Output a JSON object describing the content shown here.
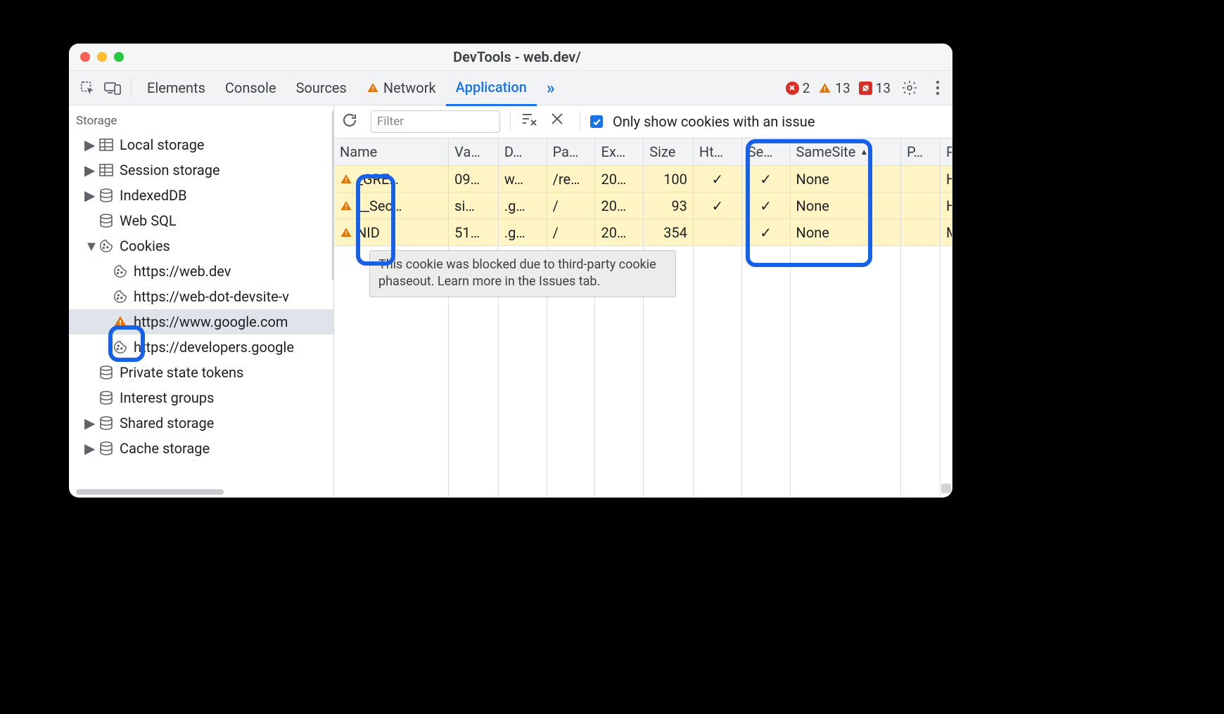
{
  "title": "DevTools - web.dev/",
  "tabs": {
    "elements": "Elements",
    "console": "Console",
    "sources": "Sources",
    "network": "Network",
    "application": "Application"
  },
  "counts": {
    "errors": "2",
    "warnings": "13",
    "issues": "13"
  },
  "sidebar": {
    "header": "Storage",
    "local_storage": "Local storage",
    "session_storage": "Session storage",
    "indexeddb": "IndexedDB",
    "websql": "Web SQL",
    "cookies": "Cookies",
    "cookie_children": {
      "0": "https://web.dev",
      "1": "https://web-dot-devsite-v",
      "2": "https://www.google.com",
      "3": "https://developers.google"
    },
    "private_state": "Private state tokens",
    "interest_groups": "Interest groups",
    "shared_storage": "Shared storage",
    "cache_storage": "Cache storage"
  },
  "toolbar": {
    "filter_placeholder": "Filter",
    "only_issues_label": "Only show cookies with an issue"
  },
  "columns": {
    "name": "Name",
    "value": "Va…",
    "domain": "D…",
    "path": "Pa…",
    "expires": "Ex…",
    "size": "Size",
    "httponly": "Ht…",
    "secure": "Se…",
    "samesite": "SameSite",
    "partition": "P…",
    "priority": "P…"
  },
  "rows": {
    "0": {
      "name": "_GRE…",
      "value": "09…",
      "domain": "w…",
      "path": "/re…",
      "expires": "20…",
      "size": "100",
      "http": "✓",
      "secure": "✓",
      "samesite": "None",
      "partition": "",
      "priority": "H…"
    },
    "1": {
      "name": "__Sec…",
      "value": "si…",
      "domain": ".g…",
      "path": "/",
      "expires": "20…",
      "size": "93",
      "http": "✓",
      "secure": "✓",
      "samesite": "None",
      "partition": "",
      "priority": "H…"
    },
    "2": {
      "name": "NID",
      "value": "51…",
      "domain": ".g…",
      "path": "/",
      "expires": "20…",
      "size": "354",
      "http": "",
      "secure": "✓",
      "samesite": "None",
      "partition": "",
      "priority": "M…"
    }
  },
  "tooltip": "This cookie was blocked due to third-party cookie phaseout. Learn more in the Issues tab."
}
